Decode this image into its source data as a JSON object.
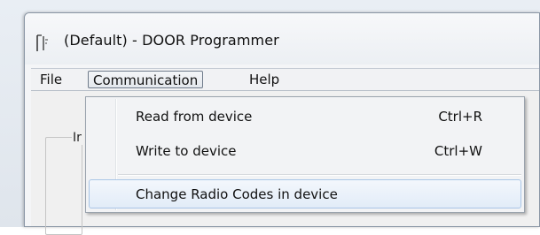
{
  "window": {
    "title": "(Default) - DOOR Programmer",
    "icon": "door-icon"
  },
  "menubar": {
    "items": [
      {
        "label": "File"
      },
      {
        "label": "Communication"
      },
      {
        "label": "Help"
      }
    ],
    "open_menu": "Communication"
  },
  "dropdown": {
    "items": [
      {
        "label": "Read from device",
        "shortcut": "Ctrl+R"
      },
      {
        "label": "Write to device",
        "shortcut": "Ctrl+W"
      },
      {
        "label": "Change Radio Codes in device",
        "shortcut": ""
      }
    ],
    "highlighted": "Change Radio Codes in device"
  },
  "client": {
    "group_label_partial": "Ir"
  },
  "colors": {
    "highlight_border": "#a9c5e6",
    "highlight_fill": "#e2ecf8",
    "menu_background": "#f2f3f5"
  }
}
